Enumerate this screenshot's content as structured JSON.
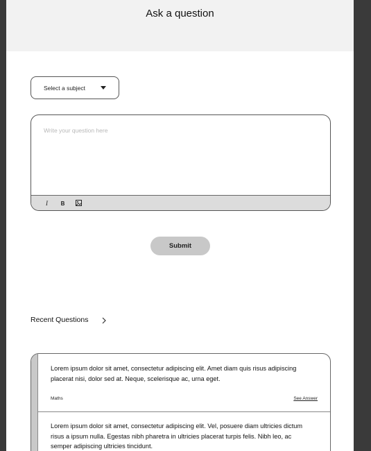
{
  "header": {
    "title": "Ask a question"
  },
  "form": {
    "subject_label": "Select a subject",
    "question_placeholder": "Write your question here",
    "question_value": "",
    "toolbar": {
      "italic": "I",
      "bold": "B"
    },
    "submit_label": "Submit"
  },
  "recent": {
    "title": "Recent Questions",
    "items": [
      {
        "text": "Lorem ipsum dolor sit amet, consectetur adipiscing elit. Amet diam quis risus adipiscing placerat nisi, dolor sed at. Neque, scelerisque ac, urna eget.",
        "subject": "Maths",
        "answer_label": "See Answer"
      },
      {
        "text": "Lorem ipsum dolor sit amet, consectetur adipiscing elit. Vel, posuere diam ultricies dictum risus a ipsum nulla. Egestas nibh pharetra in ultricies placerat turpis felis. Nibh leo, ac semper adipiscing ultricies tincidunt."
      }
    ]
  },
  "icons": {
    "dropdown": "caret-down-icon",
    "italic": "italic-icon",
    "bold": "bold-icon",
    "image": "image-icon",
    "recent": "chevron-right-icon"
  },
  "colors": {
    "header_bg": "#f2f2f2",
    "toolbar_bg": "#dcdcdc",
    "submit_bg": "#c8c8c8",
    "accent_bar": "#c9c9c9",
    "frame_bg": "#3a3a3a"
  }
}
